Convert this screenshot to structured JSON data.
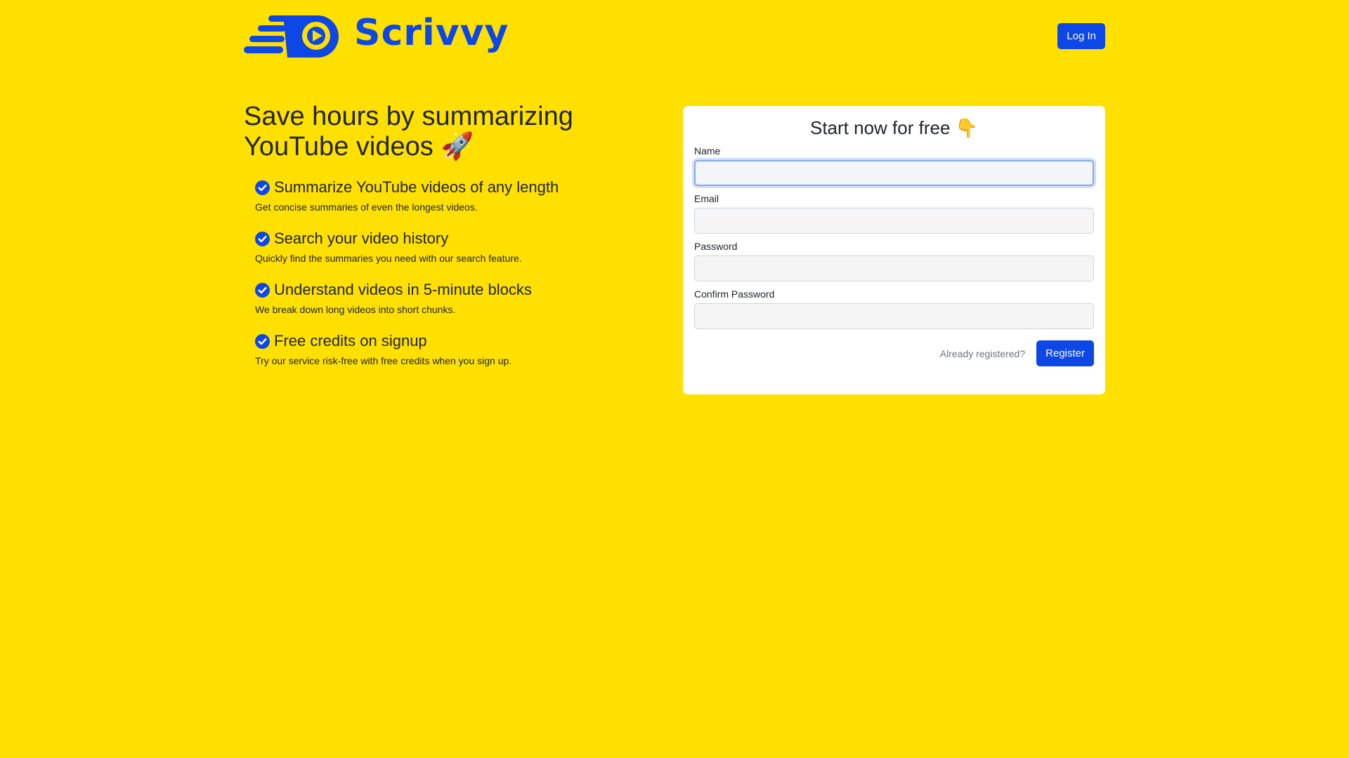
{
  "header": {
    "brand_name": "Scrivvy",
    "login_label": "Log In"
  },
  "hero": {
    "title": "Save hours by summarizing YouTube videos 🚀",
    "features": [
      {
        "icon": "check-circle-icon",
        "title": "Summarize YouTube videos of any length",
        "description": "Get concise summaries of even the longest videos."
      },
      {
        "icon": "check-circle-icon",
        "title": "Search your video history",
        "description": "Quickly find the summaries you need with our search feature."
      },
      {
        "icon": "check-circle-icon",
        "title": "Understand videos in 5-minute blocks",
        "description": "We break down long videos into short chunks."
      },
      {
        "icon": "check-circle-icon",
        "title": "Free credits on signup",
        "description": "Try our service risk-free with free credits when you sign up."
      }
    ]
  },
  "register_form": {
    "title": "Start now for free 👇",
    "fields": {
      "name": {
        "label": "Name",
        "value": ""
      },
      "email": {
        "label": "Email",
        "value": ""
      },
      "password": {
        "label": "Password",
        "value": ""
      },
      "confirm_password": {
        "label": "Confirm Password",
        "value": ""
      }
    },
    "already_registered_label": "Already registered?",
    "register_label": "Register"
  },
  "colors": {
    "background": "#FFE000",
    "accent": "#0D47E6",
    "card": "#FFFFFF"
  }
}
